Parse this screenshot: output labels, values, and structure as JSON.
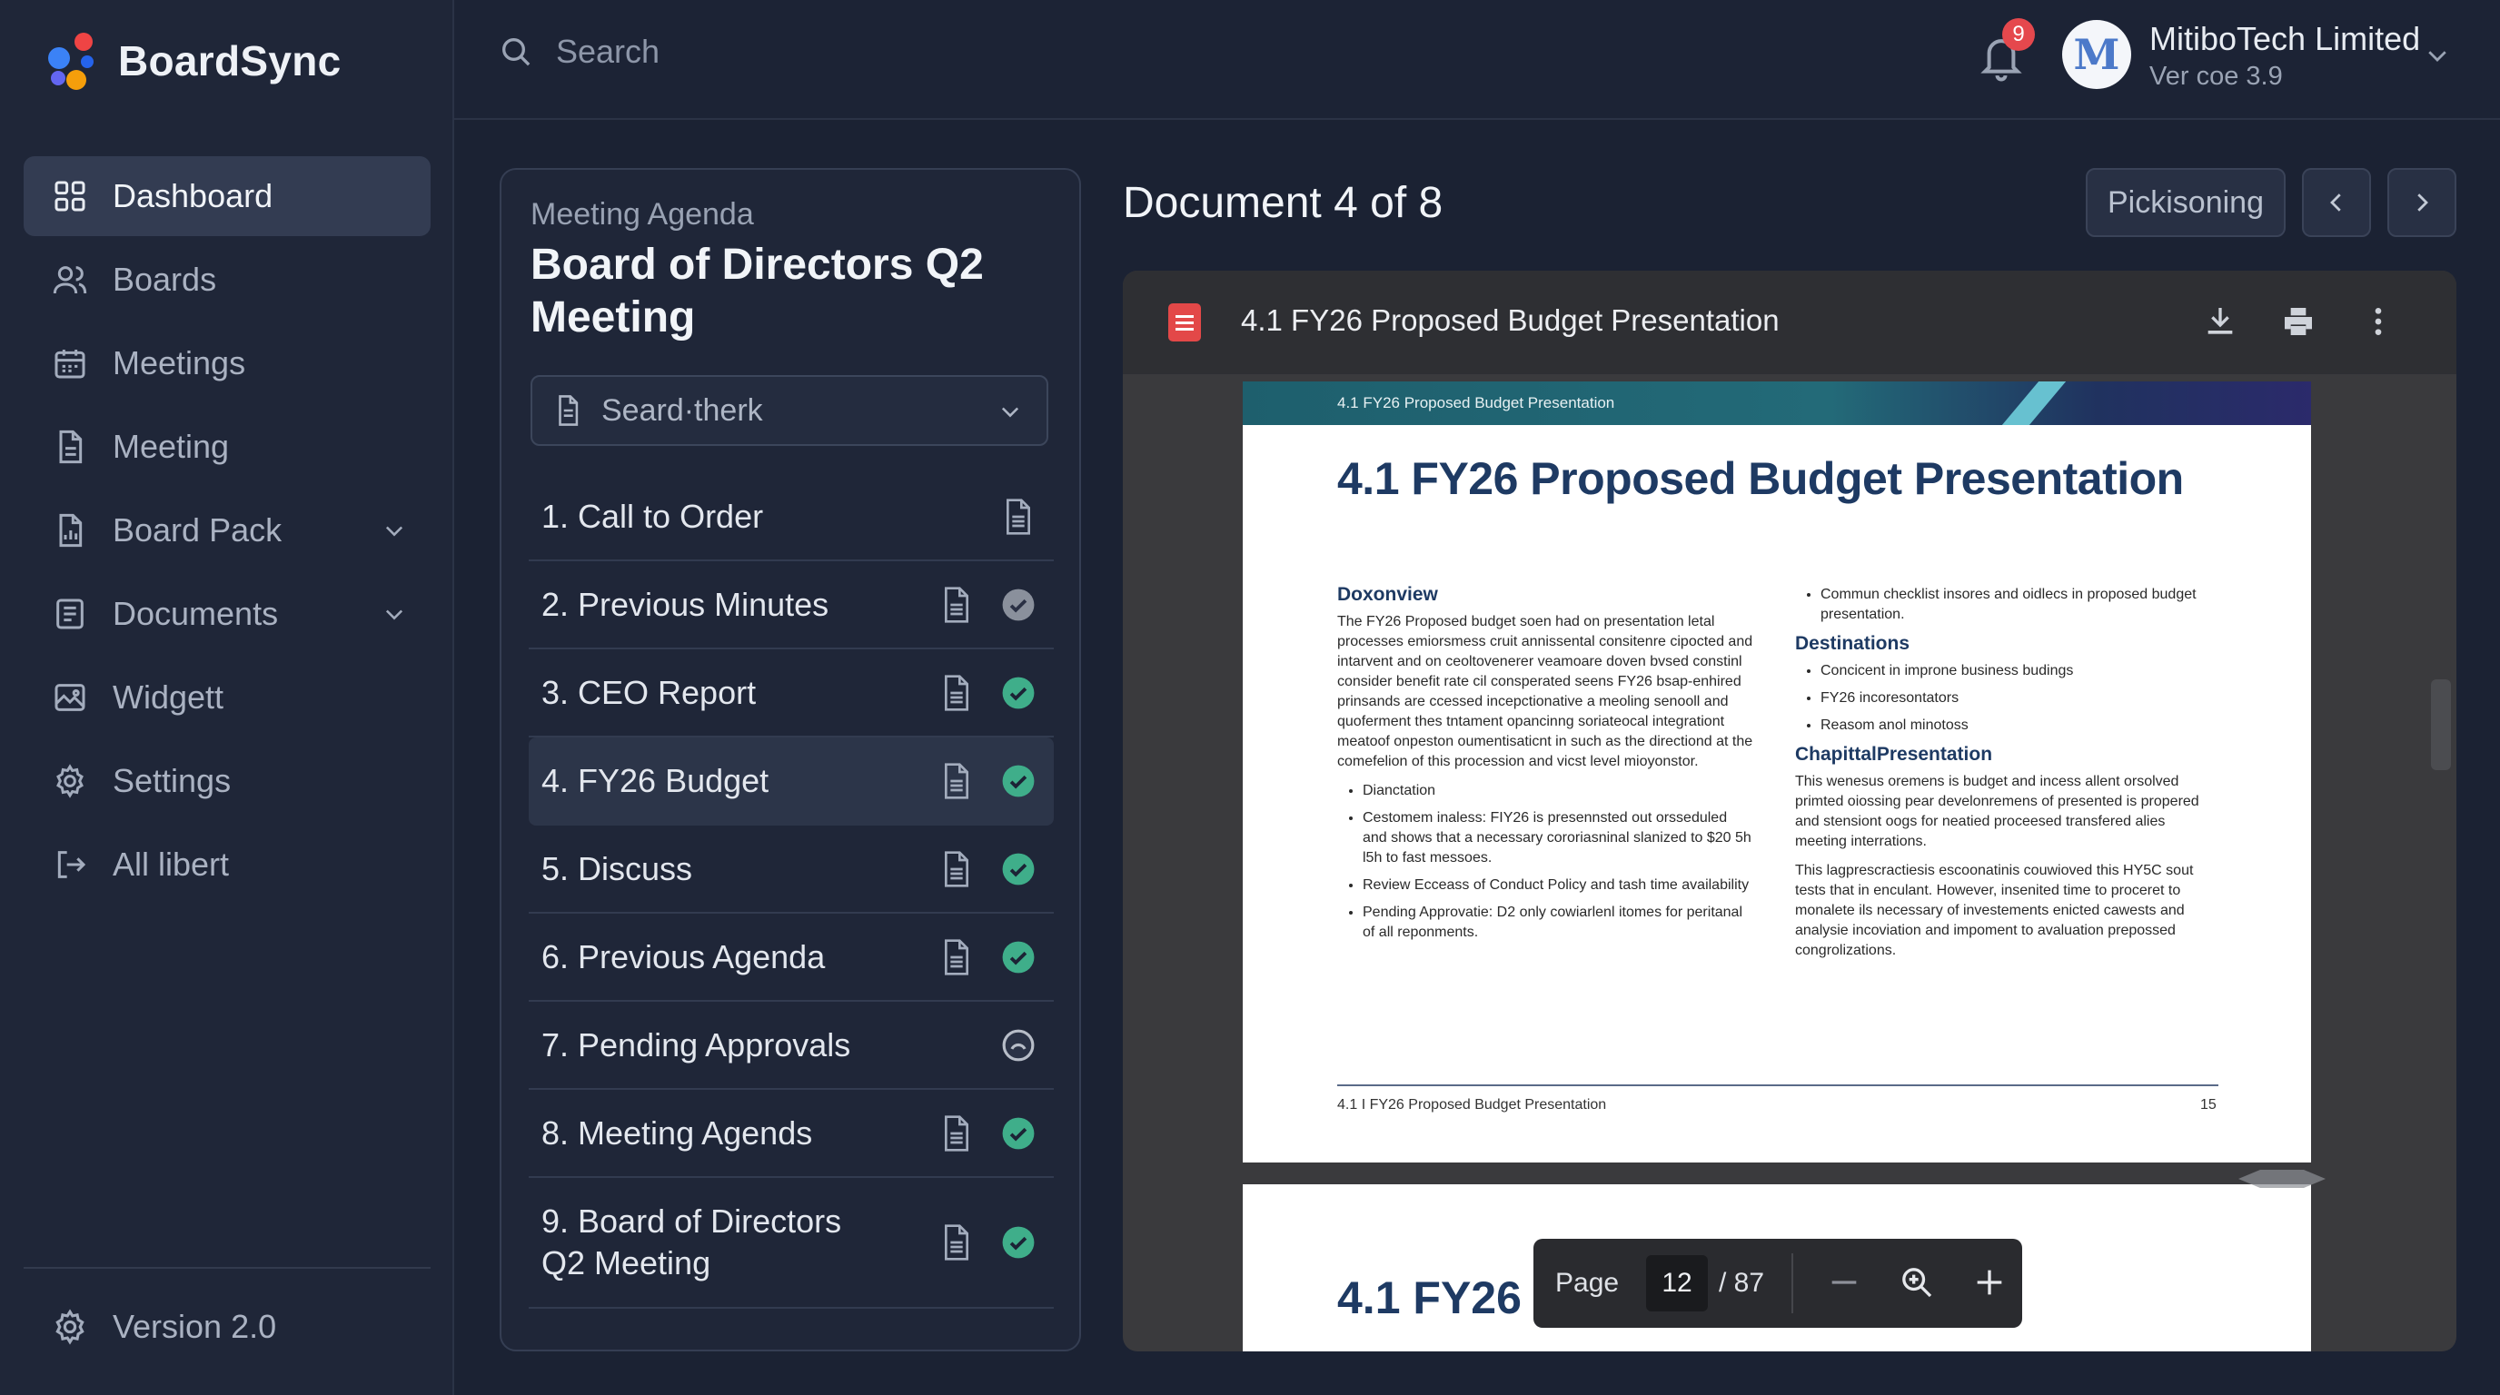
{
  "app": {
    "name": "BoardSync",
    "colors": {
      "accent_blue": "#3b82f6",
      "accent_red": "#e5484d",
      "accent_orange": "#f59e0b",
      "check_green": "#3fae8a"
    }
  },
  "sidebar": {
    "items": [
      {
        "label": "Dashboard",
        "icon": "grid-icon",
        "active": true
      },
      {
        "label": "Boards",
        "icon": "users-icon"
      },
      {
        "label": "Meetings",
        "icon": "calendar-icon"
      },
      {
        "label": "Meeting",
        "icon": "file-icon"
      },
      {
        "label": "Board Pack",
        "icon": "chart-file-icon",
        "expandable": true
      },
      {
        "label": "Documents",
        "icon": "document-list-icon",
        "expandable": true
      },
      {
        "label": "Widgett",
        "icon": "image-icon"
      },
      {
        "label": "Settings",
        "icon": "gear-icon"
      },
      {
        "label": "All libert",
        "icon": "logout-icon"
      }
    ],
    "version_label": "Version 2.0"
  },
  "topbar": {
    "search_placeholder": "Search",
    "notification_count": "9",
    "avatar_initial": "M",
    "org_name": "MitiboTech Limited",
    "org_version": "Ver coe 3.9"
  },
  "agenda": {
    "subtitle": "Meeting Agenda",
    "title": "Board of Directors Q2 Meeting",
    "filter_label": "Seard·therk",
    "items": [
      {
        "label": "1. Call to Order",
        "status": "none"
      },
      {
        "label": "2. Previous Minutes",
        "status": "pending-grey"
      },
      {
        "label": "3. CEO Report",
        "status": "done"
      },
      {
        "label": "4. FY26 Budget",
        "status": "done",
        "active": true
      },
      {
        "label": "5. Discuss",
        "status": "done"
      },
      {
        "label": "6. Previous Agenda",
        "status": "done"
      },
      {
        "label": "7. Pending Approvals",
        "status": "in-progress"
      },
      {
        "label": "8. Meeting Agends",
        "status": "done"
      },
      {
        "label": "9. Board of Directors Q2 Meeting",
        "line1": "9. Board of Directors",
        "line2": "Q2 Meeting",
        "status": "done"
      }
    ]
  },
  "document": {
    "heading": "Document 4 of 8",
    "pick_button": "Pickisoning",
    "viewer_title": "4.1 FY26 Proposed Budget Presentation",
    "page": {
      "banner": "4.1 FY26 Proposed Budget Presentation",
      "title": "4.1  FY26 Proposed Budget Presentation",
      "left": {
        "heading": "Doxonview",
        "body": "The FY26 Proposed budget soen had on presentation letal processes emiorsmess cruit annissental consitenre cipocted and intarvent and on ceoltovenerer veamoare doven bvsed constinl consider benefit rate cil consperated seens FY26 bsap-enhired prinsands are ccessed incepctionative a meoling senooll and quoferment thes tntament opancinng soriateocal integrationt meatoof onpeston oumentisaticnt in such as the directiond at the comefelion of this procession and vicst level mioyonstor.",
        "bullets": [
          "Dianctation",
          "Cestomem inaless: FIY26 is presennsted out orsseduled and shows that a necessary cororiasninal slanized to $20 5h l5h to fast messoes.",
          "Review Ecceass of Conduct Policy and tash time availability",
          "Pending Approvatie: D2 only cowiarlenl itomes for peritanal of all reponments."
        ]
      },
      "right": {
        "intro_bullets": [
          "Commun checklist insores and oidlecs in proposed budget presentation."
        ],
        "destinations_heading": "Destinations",
        "destinations": [
          "Concicent in improne business budings",
          "FY26 incoresontators",
          "Reasom anol minotoss"
        ],
        "capital_heading": "ChapittalPresentation",
        "capital_p1": "This wenesus oremens is budget and incess allent orsolved primted oiossing pear develonremens of presented is propered and stensiont oogs for neatied proceesed transfered alies meeting interrations.",
        "capital_p2": "This lagprescractiesis escoonatinis couwioved this HY5C sout tests that in enculant. However, insenited time to proceret to monalete ils necessary of investements enicted cawests and analysie incoviation and impoment to avaluation prepossed congrolizations."
      },
      "footer_left": "4.1 I FY26 Proposed Budget Presentation",
      "footer_right": "15"
    },
    "page2_title": "4.1 FY26 Propos",
    "pager": {
      "label": "Page",
      "current": "12",
      "total": "/ 87"
    }
  }
}
